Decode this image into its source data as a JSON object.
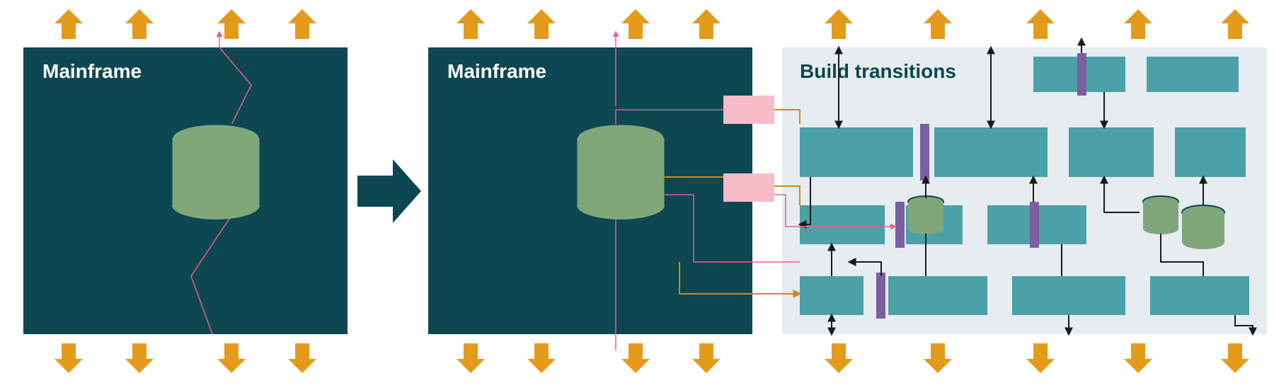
{
  "labels": {
    "mainframe_left": "Mainframe",
    "mainframe_right": "Mainframe",
    "build_transitions": "Build transitions"
  },
  "colors": {
    "mainframe_bg": "#0d4752",
    "transitions_bg": "#e6ecef",
    "arrow_orange": "#e49b1c",
    "big_arrow": "#0d4752",
    "db_fill": "#7fa77a",
    "db_stroke": "#0d4752",
    "crack_pink": "#ec5d8a",
    "pink_box": "#f7bcc8",
    "teal_tile": "#4aa1a7",
    "purple_bar": "#7a5fa3",
    "orange_line": "#cc8a1f",
    "black": "#1a1a1a",
    "white": "#ffffff"
  }
}
